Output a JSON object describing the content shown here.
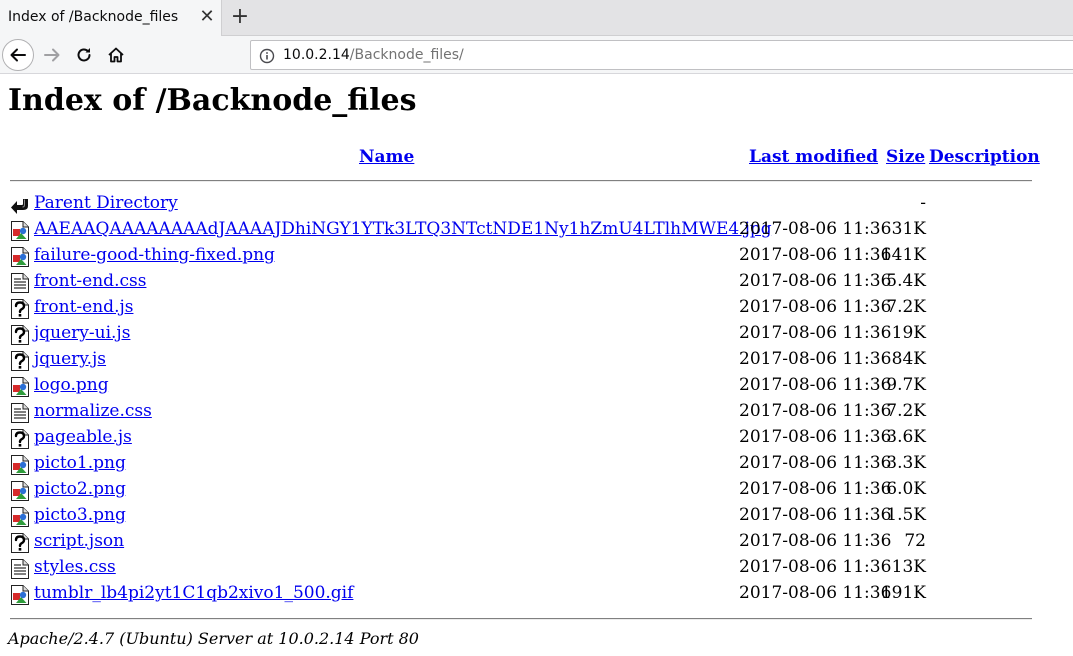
{
  "browser": {
    "tab_title": "Index of /Backnode_files",
    "tab_close_glyph": "✕",
    "new_tab_glyph": "+",
    "url_host": "10.0.2.14",
    "url_path": "/Backnode_files/"
  },
  "page": {
    "heading": "Index of /Backnode_files",
    "columns": {
      "name": "Name",
      "last_modified": "Last modified",
      "size": "Size",
      "description": "Description"
    },
    "parent": {
      "label": "Parent Directory",
      "size": "-",
      "icon": "back-arrow-icon"
    },
    "files": [
      {
        "name": "AAEAAQAAAAAAAAdJAAAAJDhiNGY1YTk3LTQ3NTctNDE1Ny1hZmU4LTlhMWE4.jpg",
        "modified": "2017-08-06 11:36",
        "size": "31K",
        "icon": "image-file-icon"
      },
      {
        "name": "failure-good-thing-fixed.png",
        "modified": "2017-08-06 11:36",
        "size": "141K",
        "icon": "image-file-icon"
      },
      {
        "name": "front-end.css",
        "modified": "2017-08-06 11:36",
        "size": "5.4K",
        "icon": "text-file-icon"
      },
      {
        "name": "front-end.js",
        "modified": "2017-08-06 11:36",
        "size": "7.2K",
        "icon": "unknown-file-icon"
      },
      {
        "name": "jquery-ui.js",
        "modified": "2017-08-06 11:36",
        "size": "19K",
        "icon": "unknown-file-icon"
      },
      {
        "name": "jquery.js",
        "modified": "2017-08-06 11:36",
        "size": "84K",
        "icon": "unknown-file-icon"
      },
      {
        "name": "logo.png",
        "modified": "2017-08-06 11:36",
        "size": "9.7K",
        "icon": "image-file-icon"
      },
      {
        "name": "normalize.css",
        "modified": "2017-08-06 11:36",
        "size": "7.2K",
        "icon": "text-file-icon"
      },
      {
        "name": "pageable.js",
        "modified": "2017-08-06 11:36",
        "size": "3.6K",
        "icon": "unknown-file-icon"
      },
      {
        "name": "picto1.png",
        "modified": "2017-08-06 11:36",
        "size": "3.3K",
        "icon": "image-file-icon"
      },
      {
        "name": "picto2.png",
        "modified": "2017-08-06 11:36",
        "size": "6.0K",
        "icon": "image-file-icon"
      },
      {
        "name": "picto3.png",
        "modified": "2017-08-06 11:36",
        "size": "1.5K",
        "icon": "image-file-icon"
      },
      {
        "name": "script.json",
        "modified": "2017-08-06 11:36",
        "size": "72",
        "icon": "unknown-file-icon"
      },
      {
        "name": "styles.css",
        "modified": "2017-08-06 11:36",
        "size": "13K",
        "icon": "text-file-icon"
      },
      {
        "name": "tumblr_lb4pi2yt1C1qb2xivo1_500.gif",
        "modified": "2017-08-06 11:36",
        "size": "191K",
        "icon": "image-file-icon"
      }
    ],
    "footer": "Apache/2.4.7 (Ubuntu) Server at 10.0.2.14 Port 80"
  },
  "colors": {
    "link": "#0000ee",
    "tabbar": "#e3e3e5",
    "toolbar": "#f5f6f7"
  }
}
